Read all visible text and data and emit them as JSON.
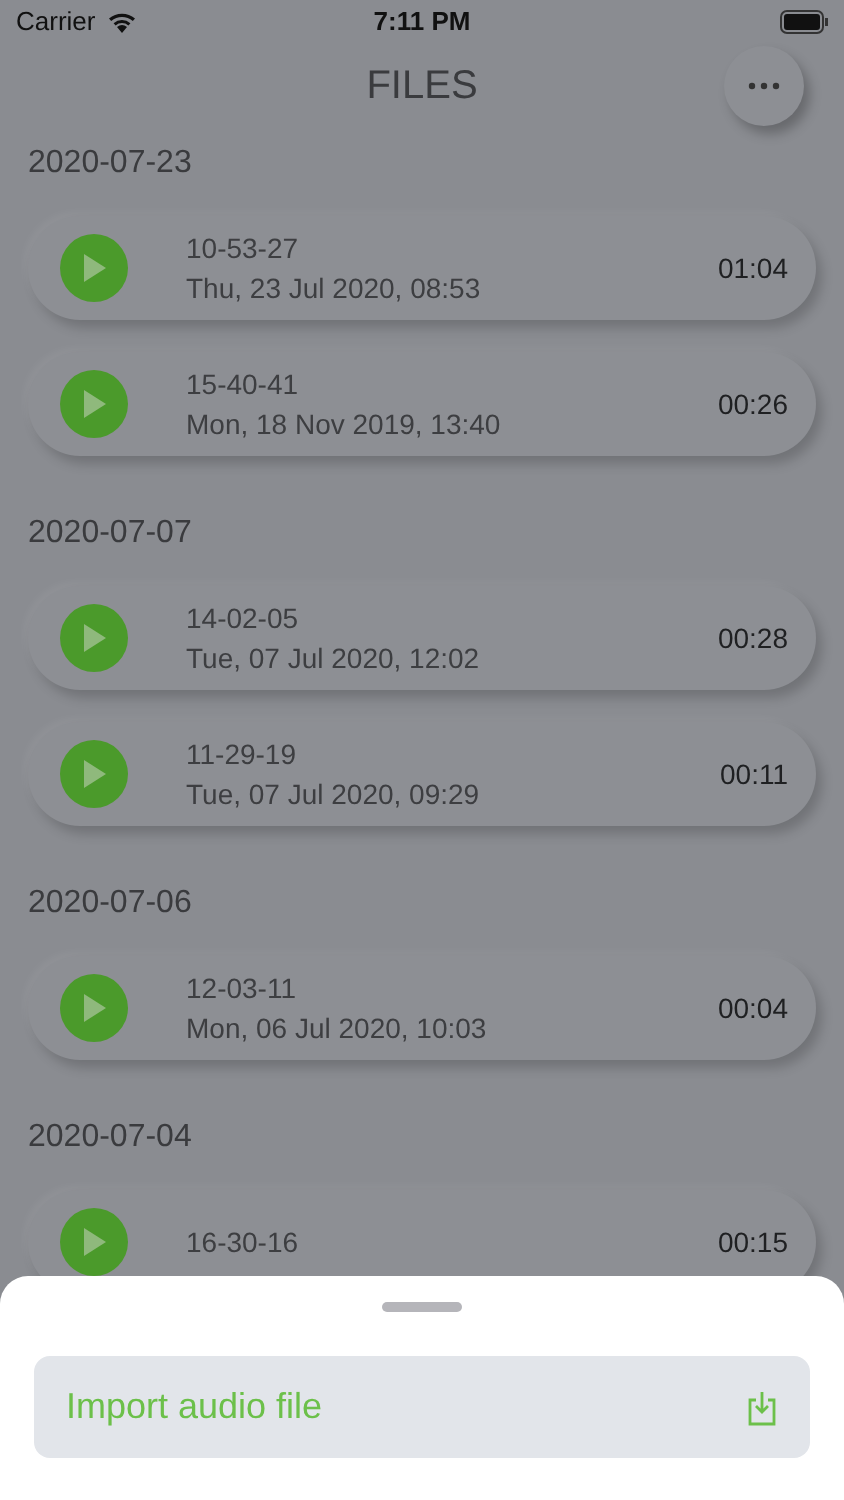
{
  "status_bar": {
    "carrier": "Carrier",
    "time": "7:11 PM"
  },
  "title": "FILES",
  "sections": [
    {
      "date": "2020-07-23",
      "recordings": [
        {
          "name": "10-53-27",
          "date": "Thu, 23 Jul 2020, 08:53",
          "duration": "01:04"
        },
        {
          "name": "15-40-41",
          "date": "Mon, 18 Nov 2019, 13:40",
          "duration": "00:26"
        }
      ]
    },
    {
      "date": "2020-07-07",
      "recordings": [
        {
          "name": "14-02-05",
          "date": "Tue, 07 Jul 2020, 12:02",
          "duration": "00:28"
        },
        {
          "name": "11-29-19",
          "date": "Tue, 07 Jul 2020, 09:29",
          "duration": "00:11"
        }
      ]
    },
    {
      "date": "2020-07-06",
      "recordings": [
        {
          "name": "12-03-11",
          "date": "Mon, 06 Jul 2020, 10:03",
          "duration": "00:04"
        }
      ]
    },
    {
      "date": "2020-07-04",
      "recordings": [
        {
          "name": "16-30-16",
          "duration": "00:15"
        }
      ]
    }
  ],
  "sheet": {
    "action": {
      "label": "Import audio file"
    }
  }
}
